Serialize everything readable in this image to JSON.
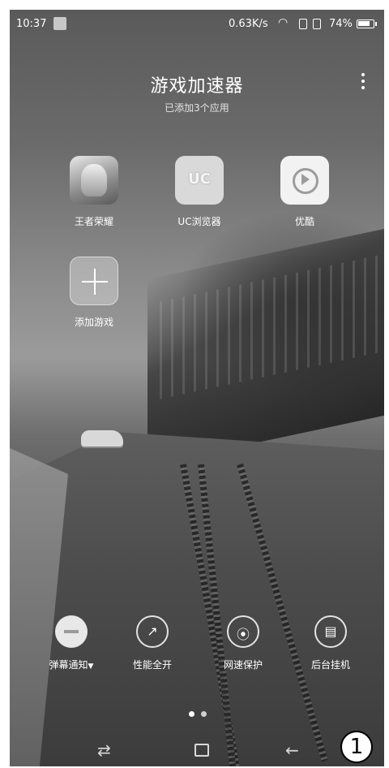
{
  "status_bar": {
    "time": "10:37",
    "network_speed": "0.63K/s",
    "battery": "74%"
  },
  "header": {
    "title": "游戏加速器",
    "subtitle": "已添加3个应用"
  },
  "apps": [
    {
      "label": "王者荣耀",
      "icon": "honor-of-kings-icon"
    },
    {
      "label": "UC浏览器",
      "icon": "uc-browser-icon"
    },
    {
      "label": "优酷",
      "icon": "youku-icon"
    },
    {
      "label": "添加游戏",
      "icon": "plus-icon"
    }
  ],
  "toolbar": [
    {
      "label": "弹幕通知",
      "icon": "minus-icon"
    },
    {
      "label": "性能全开",
      "icon": "rocket-icon"
    },
    {
      "label": "网速保护",
      "icon": "signal-icon"
    },
    {
      "label": "后台挂机",
      "icon": "box-icon"
    }
  ],
  "pager": {
    "pages": 2,
    "current": 1
  },
  "badge": "1"
}
